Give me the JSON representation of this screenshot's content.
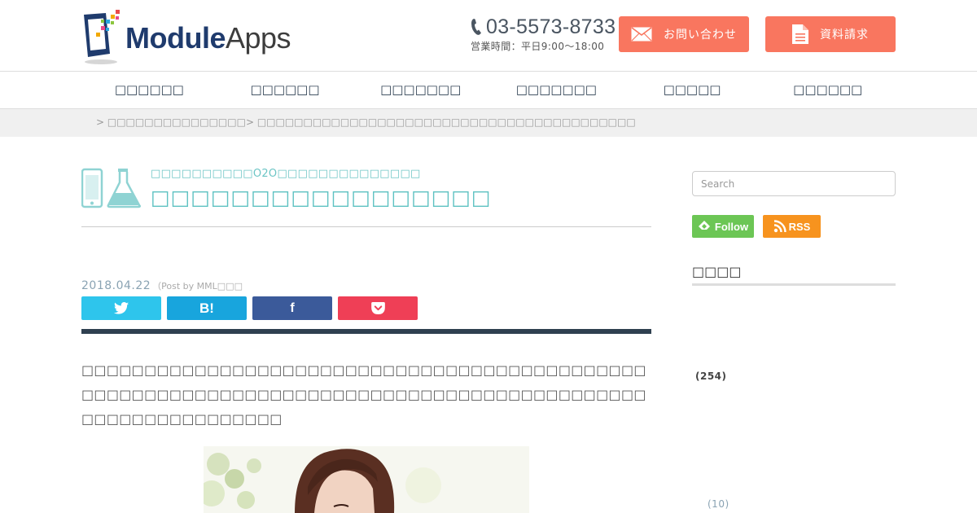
{
  "header": {
    "logo": {
      "primary": "Module",
      "secondary": "Apps"
    },
    "phone": "03-5573-8733",
    "hours": "営業時間：平日9:00〜18:00",
    "contact_button": "お問い合わせ",
    "docs_button": "資料請求"
  },
  "nav": {
    "items": [
      "□□□□□□",
      "□□□□□□",
      "□□□□□□□",
      "□□□□□□□",
      "□□□□□",
      "□□□□□□"
    ]
  },
  "breadcrumb": {
    "sep1": "> ",
    "link": "□□□□□□□□□□□□□□□",
    "sep2": "> ",
    "current": "□□□□□□□□□□□□□□□□□□□□□□□□□□□□□□□□□□□□□□□□□"
  },
  "category": {
    "subtitle": "□□□□□□□□□□O2O□□□□□□□□□□□□□□",
    "title": "□□□□□□□□□□□□□□□□□"
  },
  "post": {
    "date": "2018.04.22",
    "by": "（Post by MML□□□"
  },
  "share": {
    "hatena": "B!",
    "facebook": "f"
  },
  "article": {
    "body": "□□□□□□□□□□□□□□□□□□□□□□□□□□□□□□□□□□□□□□□□□□□□□□□□□□□□□□□□□□□□□□□□□□□□□□□□□□□□□□□□□□□□□□□□□□□□□□□□□□□□□□□□□□"
  },
  "sidebar": {
    "search_placeholder": "Search",
    "follow_label": "Follow",
    "rss_label": "RSS",
    "heading": "□□□□",
    "count_1": "(254)",
    "count_2": "(10)"
  },
  "colors": {
    "cta": "#f9765f",
    "accent_teal": "#5ec2c2",
    "twitter": "#2ec5ec",
    "hatena": "#18a5dd",
    "facebook": "#3b5a9a",
    "pocket": "#ef3f56",
    "feedly": "#6cc655",
    "rss": "#f7931e"
  },
  "icons": [
    "phone-icon",
    "mail-icon",
    "document-icon",
    "smartphone-icon",
    "flask-icon",
    "twitter-icon",
    "pocket-icon",
    "feedly-icon",
    "rss-icon"
  ]
}
